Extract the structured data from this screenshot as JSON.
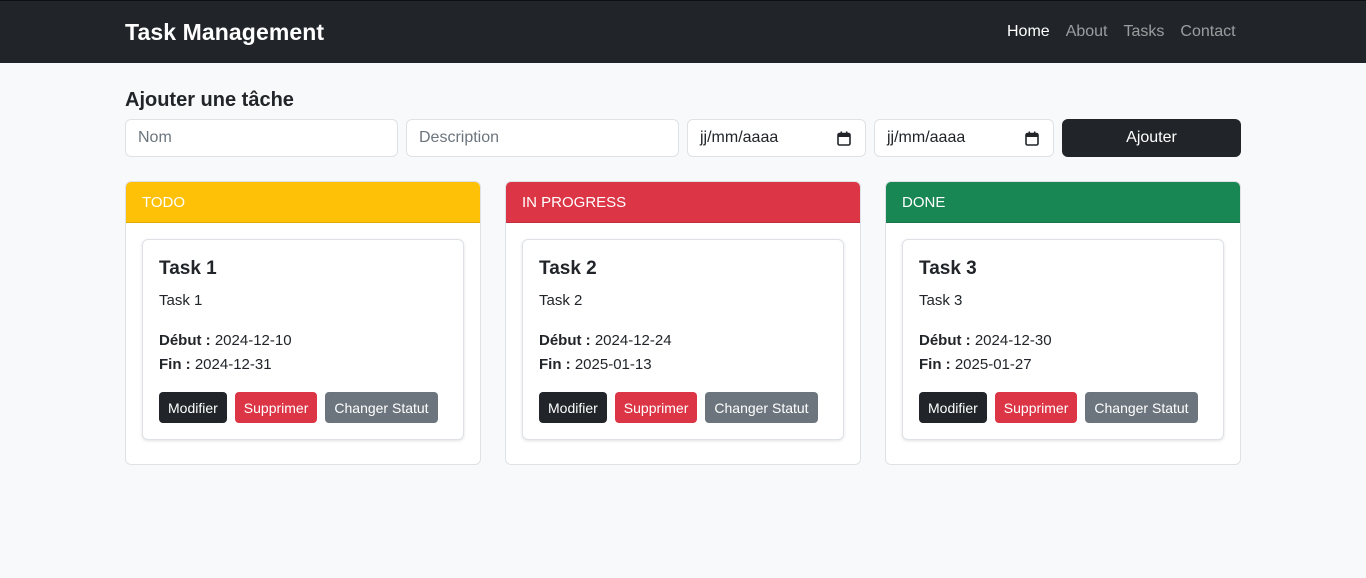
{
  "navbar": {
    "brand": "Task Management",
    "links": [
      "Home",
      "About",
      "Tasks",
      "Contact"
    ],
    "active": "Home"
  },
  "form": {
    "title": "Ajouter une tâche",
    "name_placeholder": "Nom",
    "description_placeholder": "Description",
    "start_date_value": "jj/mm/aaaa",
    "end_date_value": "jj/mm/aaaa",
    "submit_label": "Ajouter"
  },
  "colors": {
    "navbar": "#212529",
    "todo": "#ffc107",
    "in_progress": "#dc3545",
    "done": "#198754",
    "edit_button": "#212529",
    "delete_button": "#dc3545",
    "status_button": "#6c757d"
  },
  "labels": {
    "start": "Début :",
    "end": "Fin :",
    "edit": "Modifier",
    "delete": "Supprimer",
    "change_status": "Changer Statut"
  },
  "columns": [
    {
      "title": "TODO",
      "tasks": [
        {
          "title": "Task 1",
          "description": "Task 1",
          "start": "2024-12-10",
          "end": "2024-12-31"
        }
      ]
    },
    {
      "title": "IN PROGRESS",
      "tasks": [
        {
          "title": "Task 2",
          "description": "Task 2",
          "start": "2024-12-24",
          "end": "2025-01-13"
        }
      ]
    },
    {
      "title": "DONE",
      "tasks": [
        {
          "title": "Task 3",
          "description": "Task 3",
          "start": "2024-12-30",
          "end": "2025-01-27"
        }
      ]
    }
  ]
}
